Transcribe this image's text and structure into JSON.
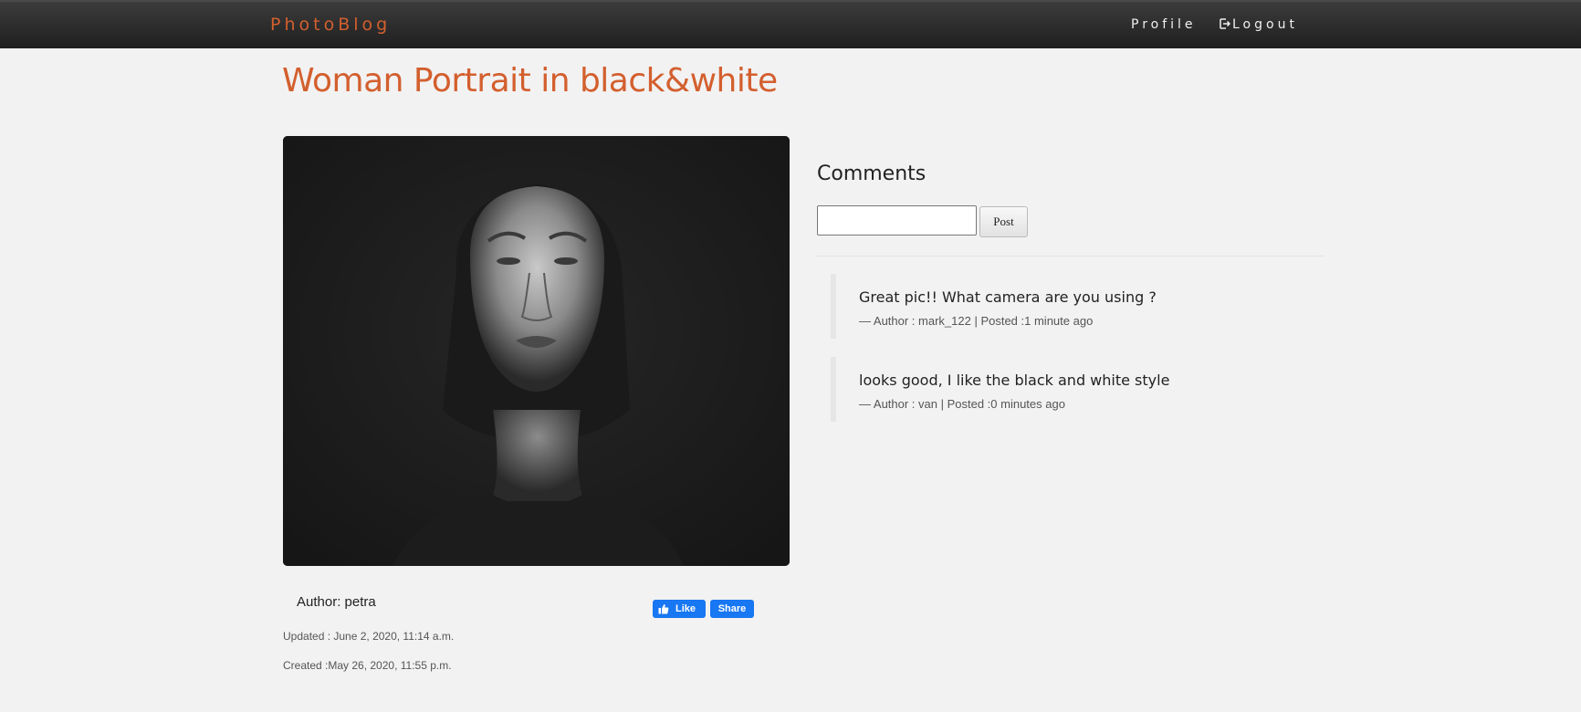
{
  "nav": {
    "brand": "PhotoBlog",
    "profile_label": "Profile",
    "logout_label": "Logout"
  },
  "post": {
    "title": "Woman Portrait in black&white",
    "author_label": "Author: petra",
    "updated": "Updated : June 2, 2020, 11:14 a.m.",
    "created": "Created :May 26, 2020, 11:55 p.m."
  },
  "social": {
    "like_label": "Like",
    "share_label": "Share"
  },
  "comments": {
    "heading": "Comments",
    "input_value": "",
    "post_label": "Post",
    "items": [
      {
        "text": "Great pic!! What camera are you using ?",
        "meta": "— Author : mark_122 | Posted :1 minute ago"
      },
      {
        "text": "looks good, I like the black and white style",
        "meta": "— Author : van | Posted :0 minutes ago"
      }
    ]
  },
  "colors": {
    "accent": "#d35f2e",
    "navbar": "#2a2a2a",
    "background": "#f2f2f2",
    "facebook": "#1877f2"
  },
  "icons": {
    "logout": "logout-icon",
    "like": "thumbs-up-icon"
  }
}
